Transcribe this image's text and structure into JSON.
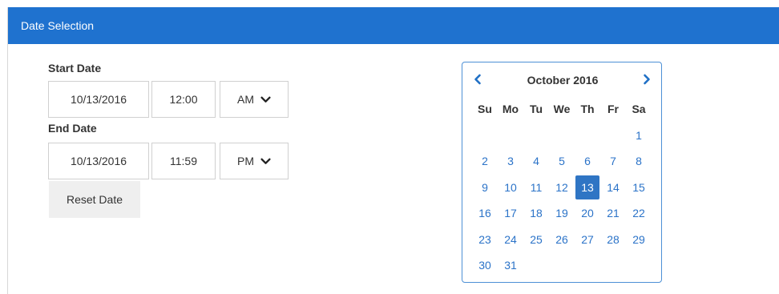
{
  "panel": {
    "title": "Date Selection"
  },
  "start": {
    "label": "Start Date",
    "date": "10/13/2016",
    "time": "12:00",
    "ampm": "AM"
  },
  "end": {
    "label": "End Date",
    "date": "10/13/2016",
    "time": "11:59",
    "ampm": "PM"
  },
  "reset_label": "Reset Date",
  "calendar": {
    "month_title": "October 2016",
    "weekdays": [
      "Su",
      "Mo",
      "Tu",
      "We",
      "Th",
      "Fr",
      "Sa"
    ],
    "first_weekday_index": 6,
    "days_in_month": 31,
    "selected_day": 13
  },
  "colors": {
    "header": "#1f72cf",
    "accent": "#2b73c8",
    "selected": "#2f75c4"
  }
}
